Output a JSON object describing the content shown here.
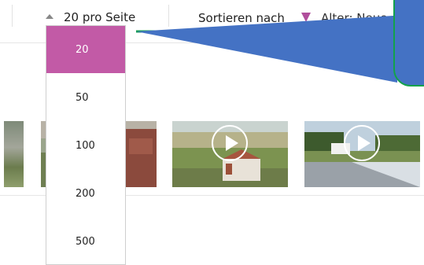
{
  "toolbar": {
    "per_page_label": "20 pro Seite",
    "sort_label": "Sortieren nach",
    "sort_value": "Alter: Neue"
  },
  "per_page_options": [
    "20",
    "50",
    "100",
    "200",
    "500"
  ],
  "selected_per_page": "20",
  "colors": {
    "accent": "#c25aa6",
    "sort_icon": "#b04e9c",
    "callout_fill": "#4472c4",
    "callout_line": "#12a24b"
  },
  "icons": [
    "caret-up-icon",
    "sort-direction-icon",
    "play-icon"
  ]
}
